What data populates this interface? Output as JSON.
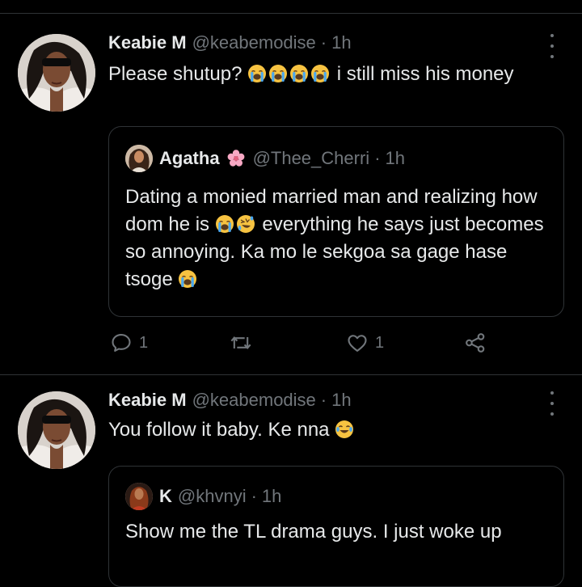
{
  "tweet1": {
    "name": "Keabie M",
    "handle": "@keabemodise",
    "dot": "·",
    "time": "1h",
    "text_before": "Please shutup?",
    "text_after": " i still miss his money",
    "quote": {
      "name": "Agatha",
      "handle": "@Thee_Cherri",
      "dot": "·",
      "time": "1h",
      "text_1": "Dating a monied married man and realizing how dom he is ",
      "text_2": " everything he says just becomes so annoying. Ka mo le sekgoa sa gage hase tsoge "
    },
    "actions": {
      "reply_count": "1",
      "like_count": "1"
    }
  },
  "tweet2": {
    "name": "Keabie M",
    "handle": "@keabemodise",
    "dot": "·",
    "time": "1h",
    "text": "You follow it baby. Ke nna ",
    "quote": {
      "name": "K",
      "handle": "@khvnyi",
      "dot": "·",
      "time": "1h",
      "text": "Show me the TL drama guys. I just woke up"
    }
  },
  "icons": {
    "crying": "loudly-crying-face",
    "rofl": "rolling-on-floor-laughing",
    "joy": "face-with-tears-of-joy",
    "flower": "cherry-blossom"
  },
  "colors": {
    "background": "#000000",
    "text": "#e7e9ea",
    "secondary": "#71767b",
    "border": "#2f3336"
  }
}
